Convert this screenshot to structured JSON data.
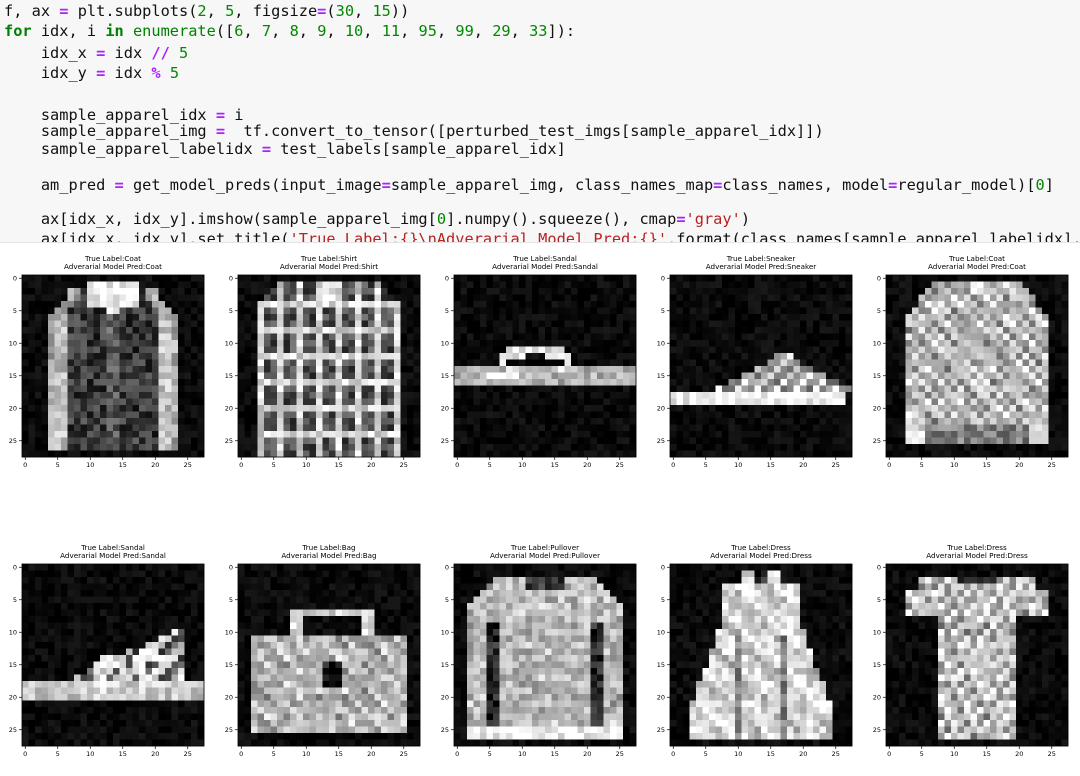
{
  "code_lines": [
    [
      [
        "",
        "f, ax "
      ],
      [
        "op",
        "="
      ],
      [
        "",
        " plt.subplots("
      ],
      [
        "num",
        "2"
      ],
      [
        "",
        ", "
      ],
      [
        "num",
        "5"
      ],
      [
        "",
        ", figsize"
      ],
      [
        "op",
        "="
      ],
      [
        "",
        "("
      ],
      [
        "num",
        "30"
      ],
      [
        "",
        ", "
      ],
      [
        "num",
        "15"
      ],
      [
        "",
        "))"
      ]
    ],
    [
      [
        "kw",
        "for"
      ],
      [
        "",
        " idx, i "
      ],
      [
        "kw",
        "in"
      ],
      [
        "",
        " "
      ],
      [
        "fn",
        "enumerate"
      ],
      [
        "",
        "(["
      ],
      [
        "num",
        "6"
      ],
      [
        "",
        ", "
      ],
      [
        "num",
        "7"
      ],
      [
        "",
        ", "
      ],
      [
        "num",
        "8"
      ],
      [
        "",
        ", "
      ],
      [
        "num",
        "9"
      ],
      [
        "",
        ", "
      ],
      [
        "num",
        "10"
      ],
      [
        "",
        ", "
      ],
      [
        "num",
        "11"
      ],
      [
        "",
        ", "
      ],
      [
        "num",
        "95"
      ],
      [
        "",
        ", "
      ],
      [
        "num",
        "99"
      ],
      [
        "",
        ", "
      ],
      [
        "num",
        "29"
      ],
      [
        "",
        ", "
      ],
      [
        "num",
        "33"
      ],
      [
        "",
        "]):"
      ]
    ],
    [
      [
        "",
        "    idx_x "
      ],
      [
        "op",
        "="
      ],
      [
        "",
        " idx "
      ],
      [
        "op",
        "//"
      ],
      [
        "",
        " "
      ],
      [
        "num",
        "5"
      ]
    ],
    [
      [
        "",
        "    idx_y "
      ],
      [
        "op",
        "="
      ],
      [
        "",
        " idx "
      ],
      [
        "op",
        "%"
      ],
      [
        "",
        " "
      ],
      [
        "num",
        "5"
      ]
    ],
    [],
    [
      [
        "",
        "    sample_apparel_idx "
      ],
      [
        "op",
        "="
      ],
      [
        "",
        " i"
      ]
    ],
    [
      [
        "",
        "    sample_apparel_img "
      ],
      [
        "op",
        "="
      ],
      [
        "",
        "  tf.convert_to_tensor([perturbed_test_imgs[sample_apparel_idx]])"
      ]
    ],
    [
      [
        "",
        "    sample_apparel_labelidx "
      ],
      [
        "op",
        "="
      ],
      [
        "",
        " test_labels[sample_apparel_idx]"
      ]
    ],
    [],
    [
      [
        "",
        "    am_pred "
      ],
      [
        "op",
        "="
      ],
      [
        "",
        " get_model_preds(input_image"
      ],
      [
        "op",
        "="
      ],
      [
        "",
        "sample_apparel_img, class_names_map"
      ],
      [
        "op",
        "="
      ],
      [
        "",
        "class_names, model"
      ],
      [
        "op",
        "="
      ],
      [
        "",
        "regular_model)["
      ],
      [
        "num",
        "0"
      ],
      [
        "",
        "]"
      ]
    ],
    [],
    [
      [
        "",
        "    ax[idx_x, idx_y].imshow(sample_apparel_img["
      ],
      [
        "num",
        "0"
      ],
      [
        "",
        "].numpy().squeeze(), cmap"
      ],
      [
        "op",
        "="
      ],
      [
        "str",
        "'gray'"
      ],
      [
        "",
        ")"
      ]
    ],
    [
      [
        "",
        "    ax[idx_x, idx_y].set_title("
      ],
      [
        "str",
        "'True Label:{}\\nAdverarial Model Pred:{}'"
      ],
      [
        "",
        ".format(class_names[sample_apparel_labelidx], a"
      ]
    ]
  ],
  "ticks": {
    "y": [
      "0",
      "5",
      "10",
      "15",
      "20",
      "25"
    ],
    "x": [
      "0",
      "5",
      "10",
      "15",
      "20",
      "25"
    ]
  },
  "subplots": [
    {
      "true_label": "True Label:Coat",
      "pred": "Adverarial Model Pred:Coat",
      "shape": "coat"
    },
    {
      "true_label": "True Label:Shirt",
      "pred": "Adverarial Model Pred:Shirt",
      "shape": "shirt"
    },
    {
      "true_label": "True Label:Sandal",
      "pred": "Adverarial Model Pred:Sandal",
      "shape": "sandal1"
    },
    {
      "true_label": "True Label:Sneaker",
      "pred": "Adverarial Model Pred:Sneaker",
      "shape": "sneaker"
    },
    {
      "true_label": "True Label:Coat",
      "pred": "Adverarial Model Pred:Coat",
      "shape": "coat2"
    },
    {
      "true_label": "True Label:Sandal",
      "pred": "Adverarial Model Pred:Sandal",
      "shape": "sandal2"
    },
    {
      "true_label": "True Label:Bag",
      "pred": "Adverarial Model Pred:Bag",
      "shape": "bag"
    },
    {
      "true_label": "True Label:Pullover",
      "pred": "Adverarial Model Pred:Pullover",
      "shape": "pullover"
    },
    {
      "true_label": "True Label:Dress",
      "pred": "Adverarial Model Pred:Dress",
      "shape": "dress"
    },
    {
      "true_label": "True Label:Dress",
      "pred": "Adverarial Model Pred:Dress",
      "shape": "tshirt"
    }
  ]
}
